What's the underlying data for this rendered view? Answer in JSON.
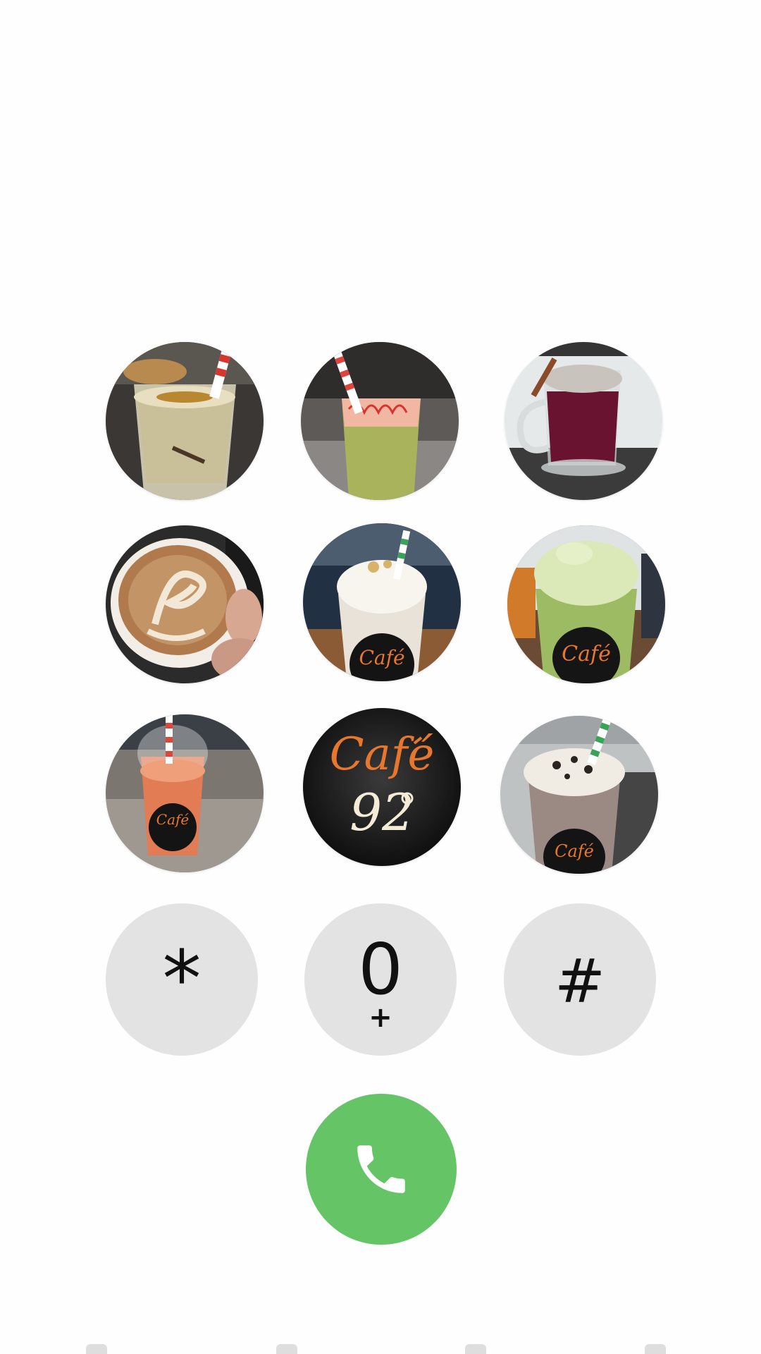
{
  "keypad": {
    "photo_tiles": [
      {
        "description": "iced biscoff drink with cookie and red straw",
        "icon": "drink-photo"
      },
      {
        "description": "green layered drink with red syrup drizzle",
        "icon": "drink-photo"
      },
      {
        "description": "dark red hot drink in glass mug with foam",
        "icon": "drink-photo"
      },
      {
        "description": "latte art coffee cup held in hand",
        "icon": "drink-photo"
      },
      {
        "description": "vanilla frappe with whipped cream and cafe sticker",
        "icon": "drink-photo"
      },
      {
        "description": "matcha frappe with whipped cream and cafe sticker",
        "icon": "drink-photo"
      },
      {
        "description": "orange iced drink in dome lid cup with cafe sticker",
        "icon": "drink-photo"
      },
      {
        "description": "Cafe 92 logo",
        "icon": "cafe-logo"
      },
      {
        "description": "cookies and cream frappe with green straw",
        "icon": "drink-photo"
      }
    ],
    "logo_word": "Café",
    "logo_number": "92",
    "star_key": "*",
    "zero_key": "0",
    "zero_key_sub": "+",
    "hash_key": "#"
  },
  "call_button": {
    "icon": "phone-icon",
    "color": "#65c466"
  },
  "colors": {
    "key_background": "#e3e3e3",
    "page_background": "#fefefe",
    "logo_orange": "#e8772e"
  }
}
